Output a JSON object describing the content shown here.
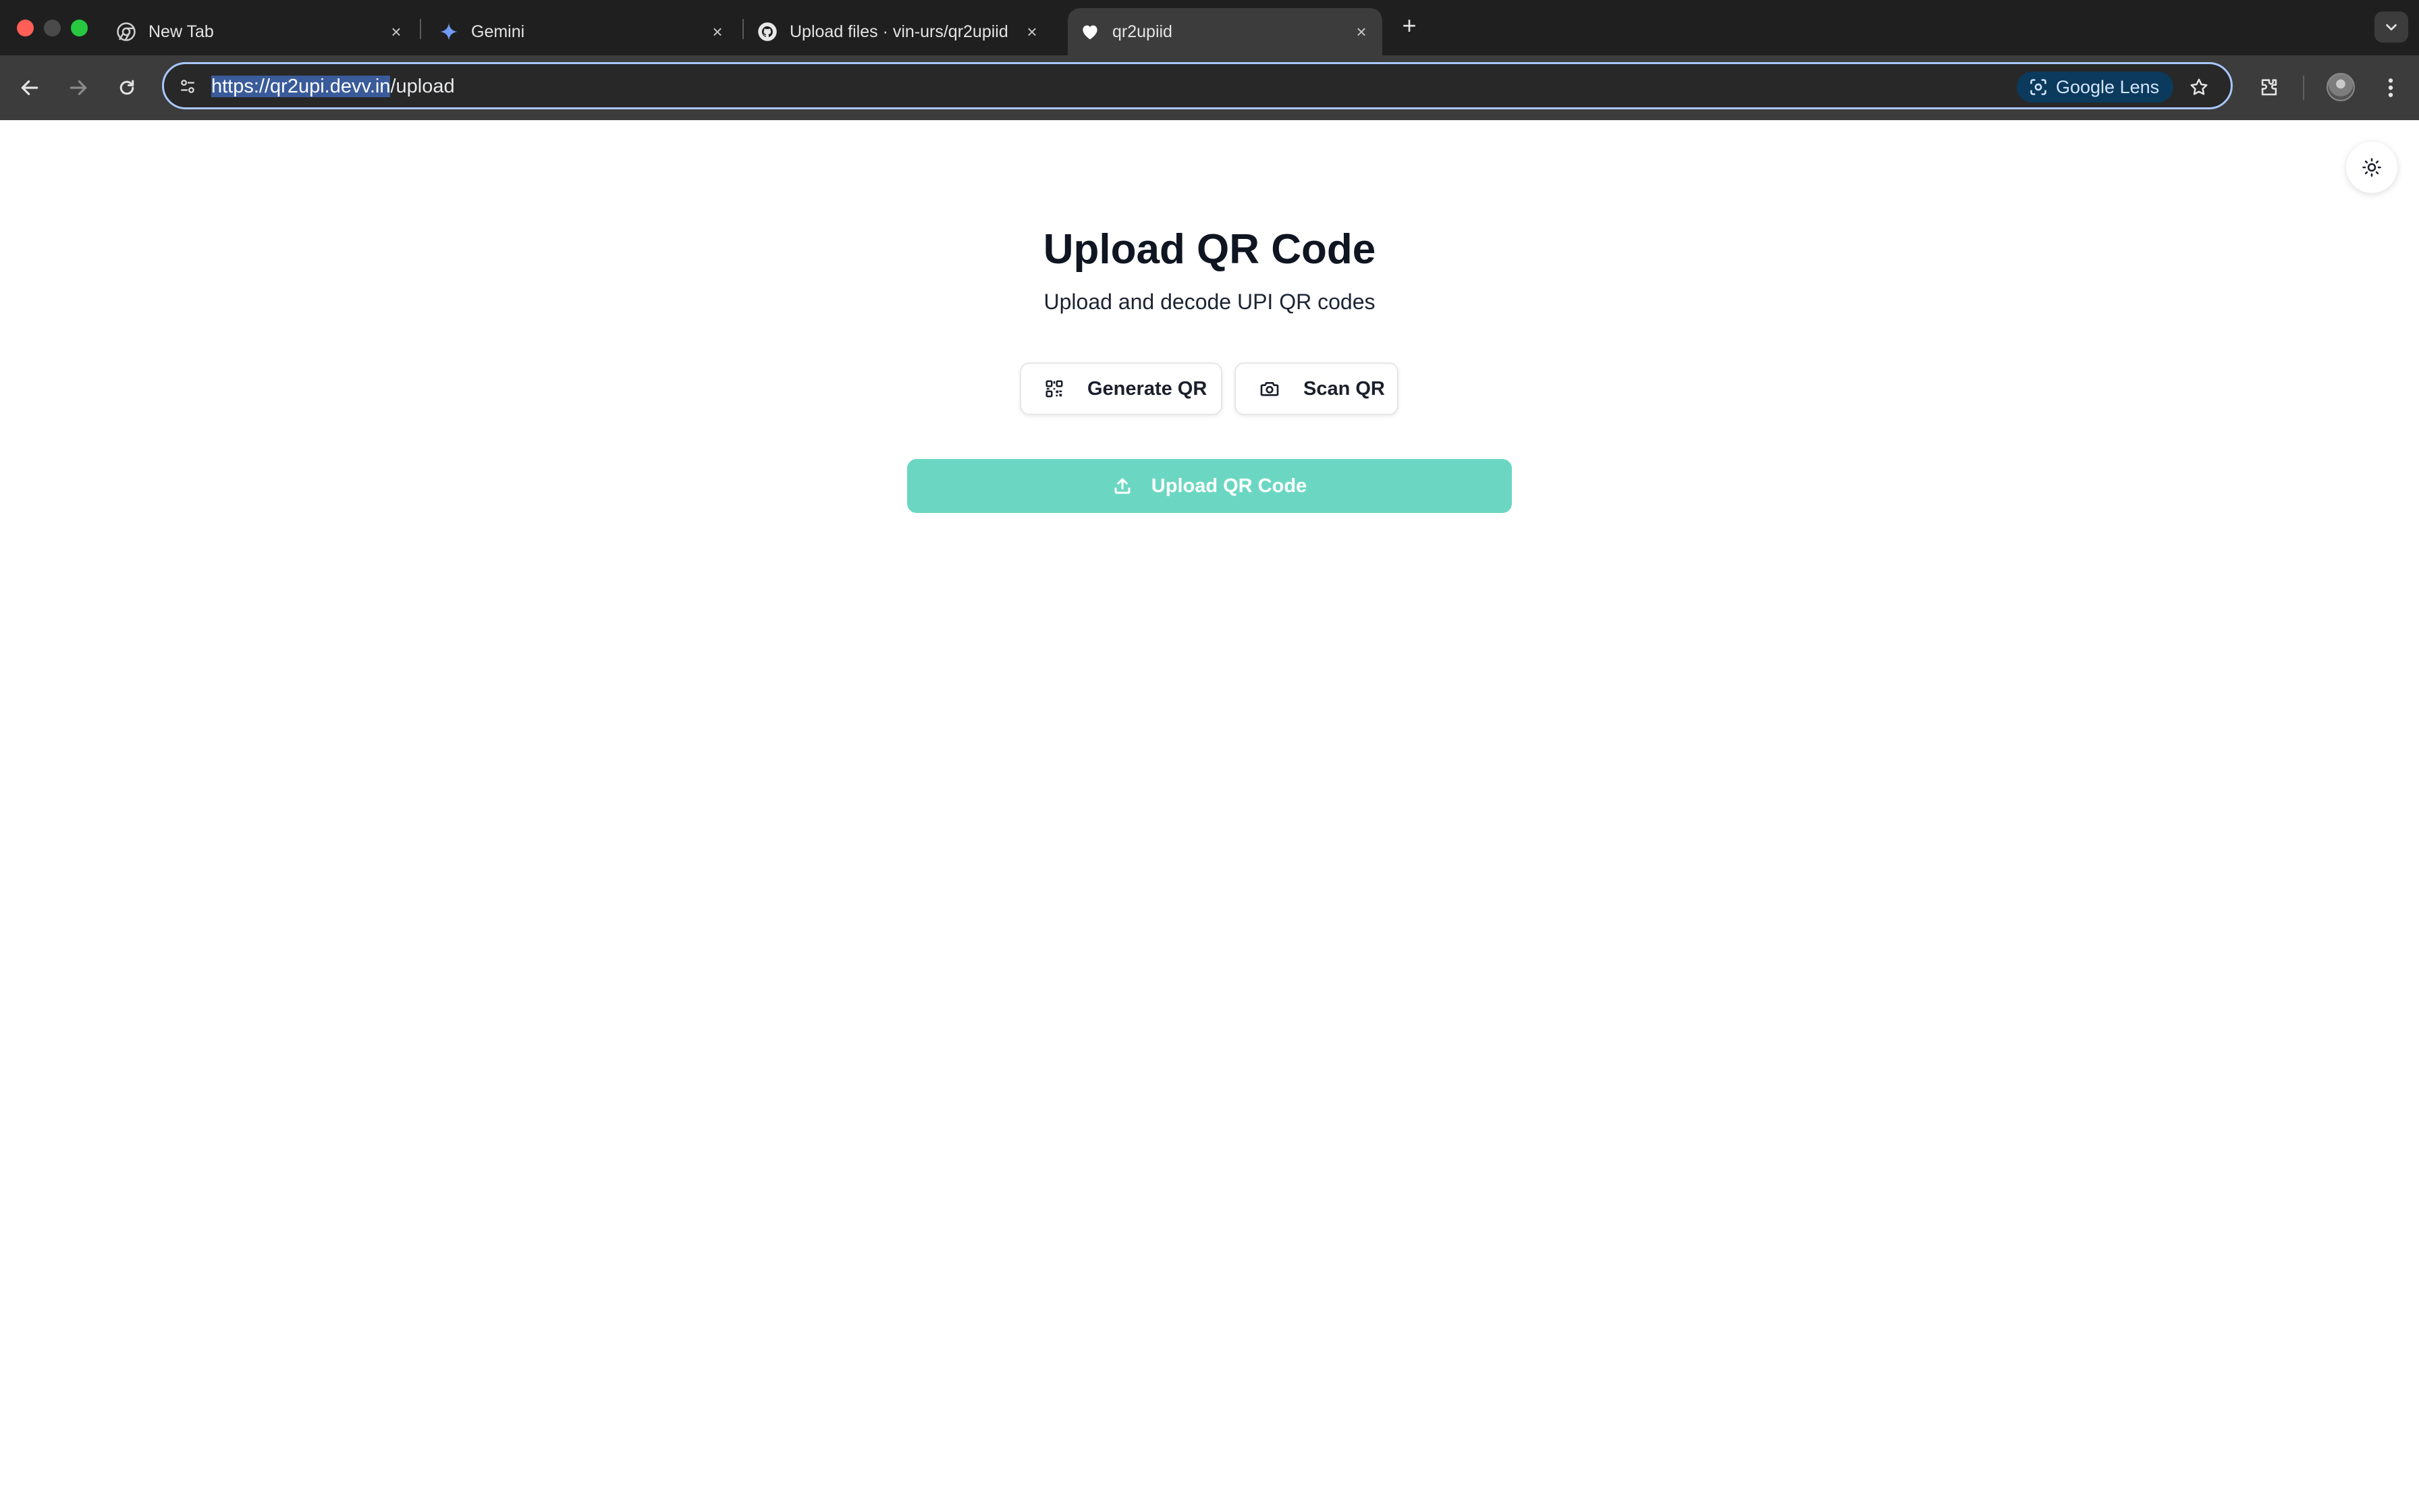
{
  "browser": {
    "tabs": [
      {
        "title": "New Tab",
        "favicon": "chrome-icon"
      },
      {
        "title": "Gemini",
        "favicon": "gemini-icon"
      },
      {
        "title": "Upload files · vin-urs/qr2upiid",
        "favicon": "github-icon"
      },
      {
        "title": "qr2upiid",
        "favicon": "heart-icon",
        "active": true
      }
    ],
    "url_selected": "https://qr2upi.devv.in",
    "url_rest": "/upload",
    "lens_label": "Google Lens"
  },
  "page": {
    "title": "Upload QR Code",
    "subtitle": "Upload and decode UPI QR codes",
    "generate_label": "Generate QR",
    "scan_label": "Scan QR",
    "upload_label": "Upload QR Code",
    "accent_color": "#6bd7c2"
  }
}
